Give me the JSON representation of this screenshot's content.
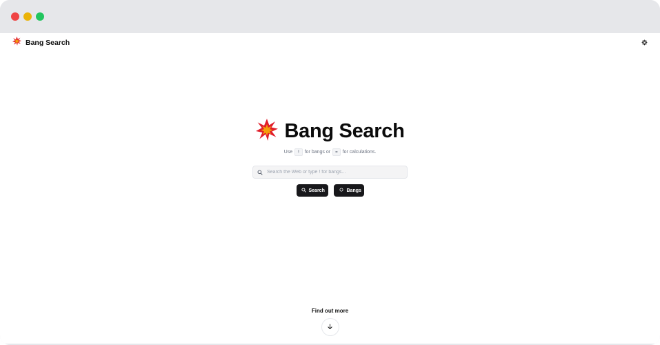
{
  "nav": {
    "brand": "Bang Search",
    "logo_icon": "collision-icon",
    "settings_icon": "gear-icon"
  },
  "hero": {
    "title": "Bang Search",
    "subtitle_prefix": "Use",
    "bang_key": "!",
    "subtitle_mid": "for bangs or",
    "calc_key": "=",
    "subtitle_suffix": "for calculations."
  },
  "search": {
    "placeholder": "Search the Web or type ! for bangs...",
    "value": ""
  },
  "buttons": {
    "search_label": "Search",
    "bangs_label": "Bangs"
  },
  "footer": {
    "find_out_more": "Find out more"
  },
  "colors": {
    "brand_red": "#e11d2a",
    "brand_yellow": "#f59e0b",
    "button_bg": "#18181b"
  }
}
